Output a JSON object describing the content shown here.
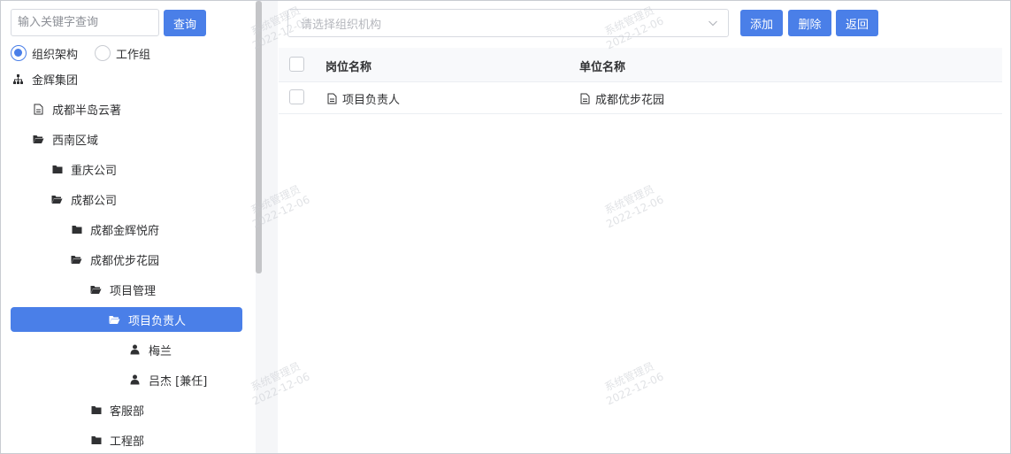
{
  "search": {
    "placeholder": "输入关键字查询",
    "button": "查询"
  },
  "tree_type": {
    "options": [
      "组织架构",
      "工作组"
    ],
    "selected": 0
  },
  "tree": [
    {
      "label": "金辉集团",
      "icon": "org-icon"
    },
    {
      "label": "成都半岛云著",
      "icon": "document-icon"
    },
    {
      "label": "西南区域",
      "icon": "folder-open-icon"
    },
    {
      "label": "重庆公司",
      "icon": "folder-icon"
    },
    {
      "label": "成都公司",
      "icon": "folder-open-icon"
    },
    {
      "label": "成都金辉悦府",
      "icon": "folder-icon"
    },
    {
      "label": "成都优步花园",
      "icon": "folder-open-icon"
    },
    {
      "label": "项目管理",
      "icon": "folder-open-icon"
    },
    {
      "label": "项目负责人",
      "icon": "folder-open-icon",
      "selected": true
    },
    {
      "label": "梅兰",
      "icon": "user-icon"
    },
    {
      "label": "吕杰 [兼任]",
      "icon": "user-icon"
    },
    {
      "label": "客服部",
      "icon": "folder-icon"
    },
    {
      "label": "工程部",
      "icon": "folder-icon"
    }
  ],
  "org_select": {
    "placeholder": "请选择组织机构"
  },
  "toolbar": {
    "add": "添加",
    "delete": "删除",
    "back": "返回"
  },
  "table": {
    "columns": [
      "岗位名称",
      "单位名称"
    ],
    "rows": [
      {
        "position": "项目负责人",
        "unit": "成都优步花园"
      }
    ]
  },
  "watermark": {
    "user": "系统管理员",
    "date": "2022-12-06"
  },
  "colors": {
    "primary": "#4a7fe8",
    "border": "#d7dae0",
    "header_bg": "#f8f9fb"
  }
}
